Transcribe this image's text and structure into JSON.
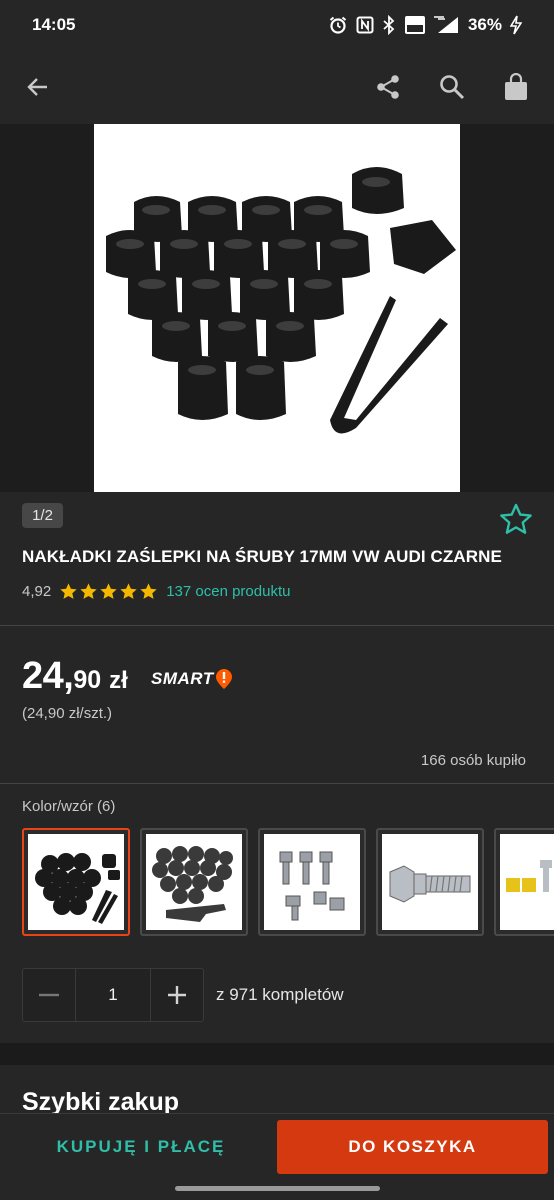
{
  "status_bar": {
    "time": "14:05",
    "battery": "36%"
  },
  "app_bar": {
    "icons": [
      "back-arrow-icon",
      "share-icon",
      "search-icon",
      "shopping-bag-icon"
    ]
  },
  "gallery": {
    "counter": "1/2"
  },
  "product": {
    "title": "NAKŁADKI ZAŚLEPKI NA ŚRUBY 17MM VW AUDI CZARNE",
    "rating_value": "4,92",
    "stars": 5,
    "rating_count": "137 ocen produktu",
    "price_int": "24,",
    "price_dec": "90",
    "currency": "zł",
    "smart_label": "SMART",
    "unit_price": "(24,90 zł/szt.)",
    "bought": "166 osób kupiło"
  },
  "variants": {
    "label": "Kolor/wzór (6)",
    "selected_index": 0
  },
  "quantity": {
    "value": "1",
    "stock": "z 971 kompletów"
  },
  "quick_buy": {
    "title": "Szybki zakup"
  },
  "bottom": {
    "buy_label": "KUPUJĘ I PŁACĘ",
    "cart_label": "DO KOSZYKA"
  },
  "colors": {
    "accent": "#2fbfa8",
    "brand": "#d4390f",
    "star": "#f5b800",
    "background": "#262626"
  }
}
